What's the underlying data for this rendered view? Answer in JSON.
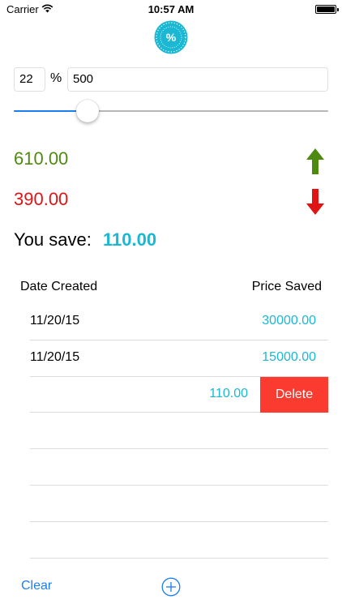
{
  "status_bar": {
    "carrier": "Carrier",
    "time": "10:57 AM"
  },
  "calculator": {
    "percent_value": "22",
    "percent_symbol": "%",
    "price_value": "500",
    "slider_level": 0.235,
    "increased_value": "610.00",
    "decreased_value": "390.00",
    "save_label": "You save:",
    "save_amount": "110.00"
  },
  "history": {
    "columns": {
      "date": "Date Created",
      "price": "Price Saved"
    },
    "rows": [
      {
        "date": "11/20/15",
        "amount": "30000.00"
      },
      {
        "date": "11/20/15",
        "amount": "15000.00"
      },
      {
        "date": "",
        "amount": "110.00",
        "delete_label": "Delete"
      }
    ],
    "empty_row_count": 4
  },
  "toolbar": {
    "clear_label": "Clear"
  },
  "colors": {
    "accent": "#1bb7d3",
    "tint": "#1a7ef5",
    "increase": "#4f8a10",
    "decrease": "#e01414",
    "delete": "#fb3b30"
  }
}
